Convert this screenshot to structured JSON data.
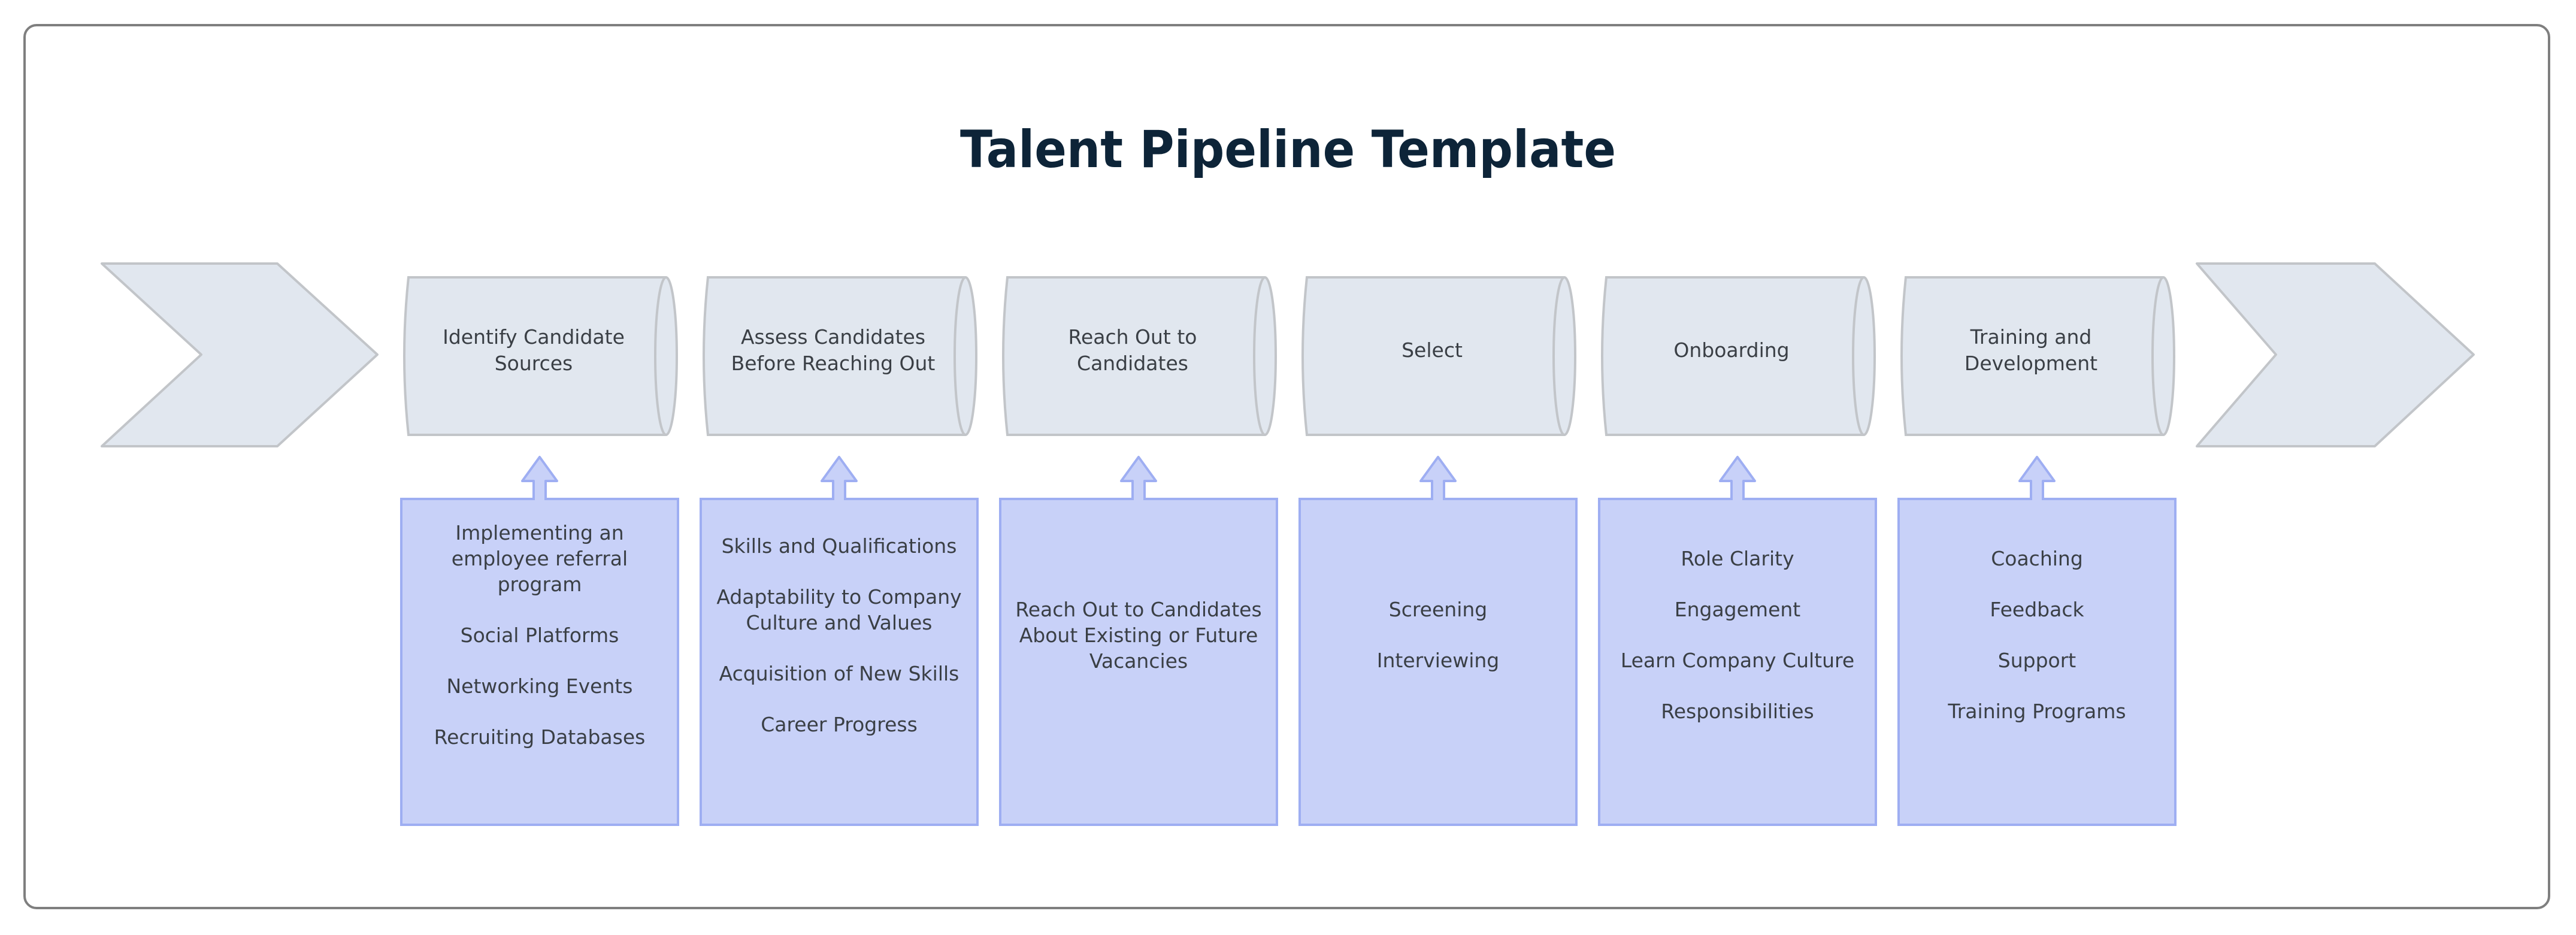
{
  "title": "Talent Pipeline Template",
  "colors": {
    "title": "#0d2438",
    "stage_fill": "#e1e7ef",
    "stage_stroke": "#c2c5c9",
    "detail_fill": "#c8d1f8",
    "detail_stroke": "#9eaef2",
    "frame": "#7f7f7f",
    "text": "#3a3f45"
  },
  "start_chevron": {
    "icon": "chevron-right-icon"
  },
  "end_chevron": {
    "icon": "chevron-right-icon"
  },
  "stages": [
    {
      "label": "Identify Candidate Sources",
      "details": [
        "Implementing an employee referral program",
        "Social Platforms",
        "Networking Events",
        "Recruiting Databases"
      ]
    },
    {
      "label": "Assess Candidates Before Reaching Out",
      "details": [
        "Skills and Qualifications",
        "Adaptability to Company Culture and Values",
        "Acquisition of New Skills",
        "Career Progress"
      ]
    },
    {
      "label": "Reach Out to Candidates",
      "details": [
        "Reach Out to Candidates About Existing or Future Vacancies"
      ]
    },
    {
      "label": "Select",
      "details": [
        "Screening",
        "Interviewing"
      ]
    },
    {
      "label": "Onboarding",
      "details": [
        "Role Clarity",
        "Engagement",
        "Learn Company Culture",
        "Responsibilities"
      ]
    },
    {
      "label": "Training and Development",
      "details": [
        "Coaching",
        "Feedback",
        "Support",
        "Training Programs"
      ]
    }
  ]
}
